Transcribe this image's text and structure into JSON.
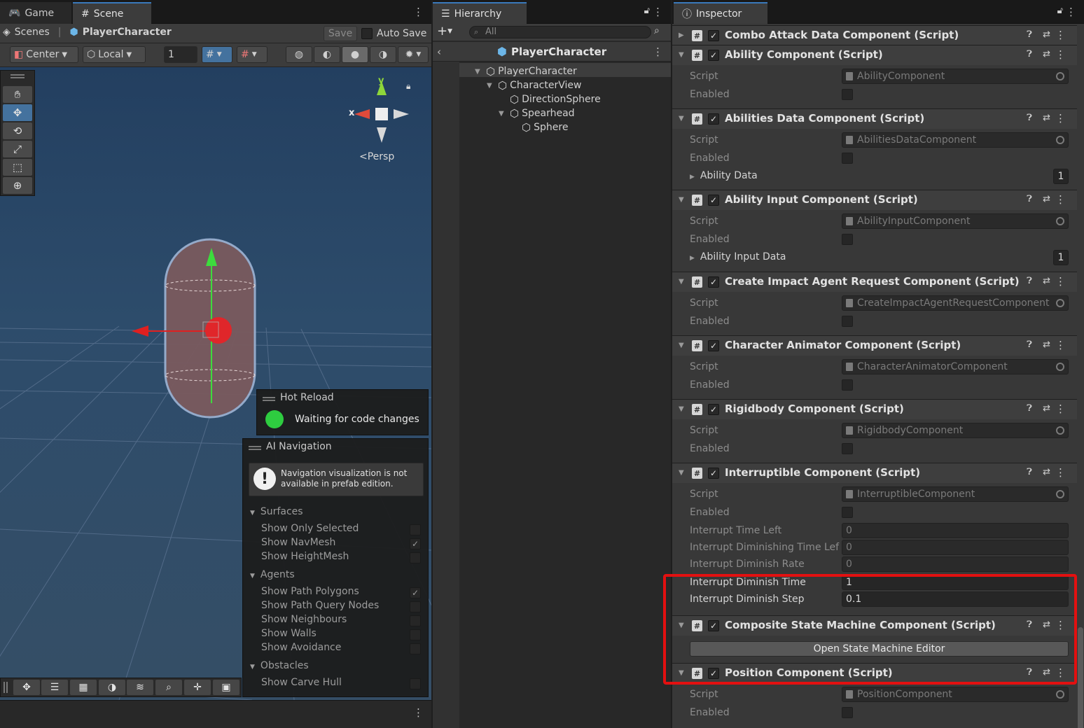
{
  "scene_panel": {
    "tabs": [
      {
        "label": "Game"
      },
      {
        "label": "Scene"
      }
    ],
    "breadcrumb": {
      "scenes": "Scenes",
      "separator": "|",
      "prefab": "PlayerCharacter"
    },
    "save_label": "Save",
    "auto_save_label": "Auto Save",
    "pivot_label": "Center",
    "space_label": "Local",
    "grid_size_value": "1",
    "gizmo": {
      "y_label": "y",
      "x_label": "x",
      "projection_label": "Persp"
    },
    "hot_reload": {
      "title": "Hot Reload",
      "status": "Waiting for code changes",
      "status_color": "#2ecc40"
    },
    "ai_navigation": {
      "title": "AI Navigation",
      "warning": "Navigation visualization is not available in prefab edition.",
      "sections": [
        {
          "label": "Surfaces",
          "items": [
            {
              "label": "Show Only Selected",
              "checked": false
            },
            {
              "label": "Show NavMesh",
              "checked": true
            },
            {
              "label": "Show HeightMesh",
              "checked": false
            }
          ]
        },
        {
          "label": "Agents",
          "items": [
            {
              "label": "Show Path Polygons",
              "checked": true
            },
            {
              "label": "Show Path Query Nodes",
              "checked": false
            },
            {
              "label": "Show Neighbours",
              "checked": false
            },
            {
              "label": "Show Walls",
              "checked": false
            },
            {
              "label": "Show Avoidance",
              "checked": false
            }
          ]
        },
        {
          "label": "Obstacles",
          "items": [
            {
              "label": "Show Carve Hull",
              "checked": false
            }
          ]
        }
      ]
    }
  },
  "hierarchy": {
    "tab_label": "Hierarchy",
    "search_placeholder": "All",
    "prefab_header": "PlayerCharacter",
    "items": [
      {
        "label": "PlayerCharacter",
        "depth": 0,
        "expanded": true
      },
      {
        "label": "CharacterView",
        "depth": 1,
        "expanded": true
      },
      {
        "label": "DirectionSphere",
        "depth": 2,
        "expanded": false
      },
      {
        "label": "Spearhead",
        "depth": 2,
        "expanded": true
      },
      {
        "label": "Sphere",
        "depth": 3,
        "expanded": false
      }
    ]
  },
  "inspector": {
    "tab_label": "Inspector",
    "labels": {
      "script": "Script",
      "enabled": "Enabled"
    },
    "components": [
      {
        "title": "Combo Attack Data Component (Script)",
        "collapsed": true
      },
      {
        "title": "Ability Component (Script)",
        "script": "AbilityComponent"
      },
      {
        "title": "Abilities Data Component (Script)",
        "script": "AbilitiesDataComponent",
        "array": {
          "label": "Ability Data",
          "count": "1"
        }
      },
      {
        "title": "Ability Input Component (Script)",
        "script": "AbilityInputComponent",
        "array": {
          "label": "Ability Input Data",
          "count": "1"
        }
      },
      {
        "title": "Create Impact Agent Request Component (Script)",
        "script": "CreateImpactAgentRequestComponent"
      },
      {
        "title": "Character Animator Component (Script)",
        "script": "CharacterAnimatorComponent"
      },
      {
        "title": "Rigidbody Component (Script)",
        "script": "RigidbodyComponent"
      },
      {
        "title": "Interruptible Component (Script)",
        "script": "InterruptibleComponent",
        "fields": [
          {
            "label": "Interrupt Time Left",
            "value": "0"
          },
          {
            "label": "Interrupt Diminishing Time Lef",
            "value": "0"
          },
          {
            "label": "Interrupt Diminish Rate",
            "value": "0"
          },
          {
            "label": "Interrupt Diminish Time",
            "value": "1"
          },
          {
            "label": "Interrupt Diminish Step",
            "value": "0.1"
          }
        ]
      },
      {
        "title": "Composite State Machine Component (Script)",
        "button": "Open State Machine Editor"
      },
      {
        "title": "Position Component (Script)",
        "script": "PositionComponent"
      }
    ]
  },
  "colors": {
    "highlight": "#e31010",
    "accent": "#3a79bb"
  }
}
